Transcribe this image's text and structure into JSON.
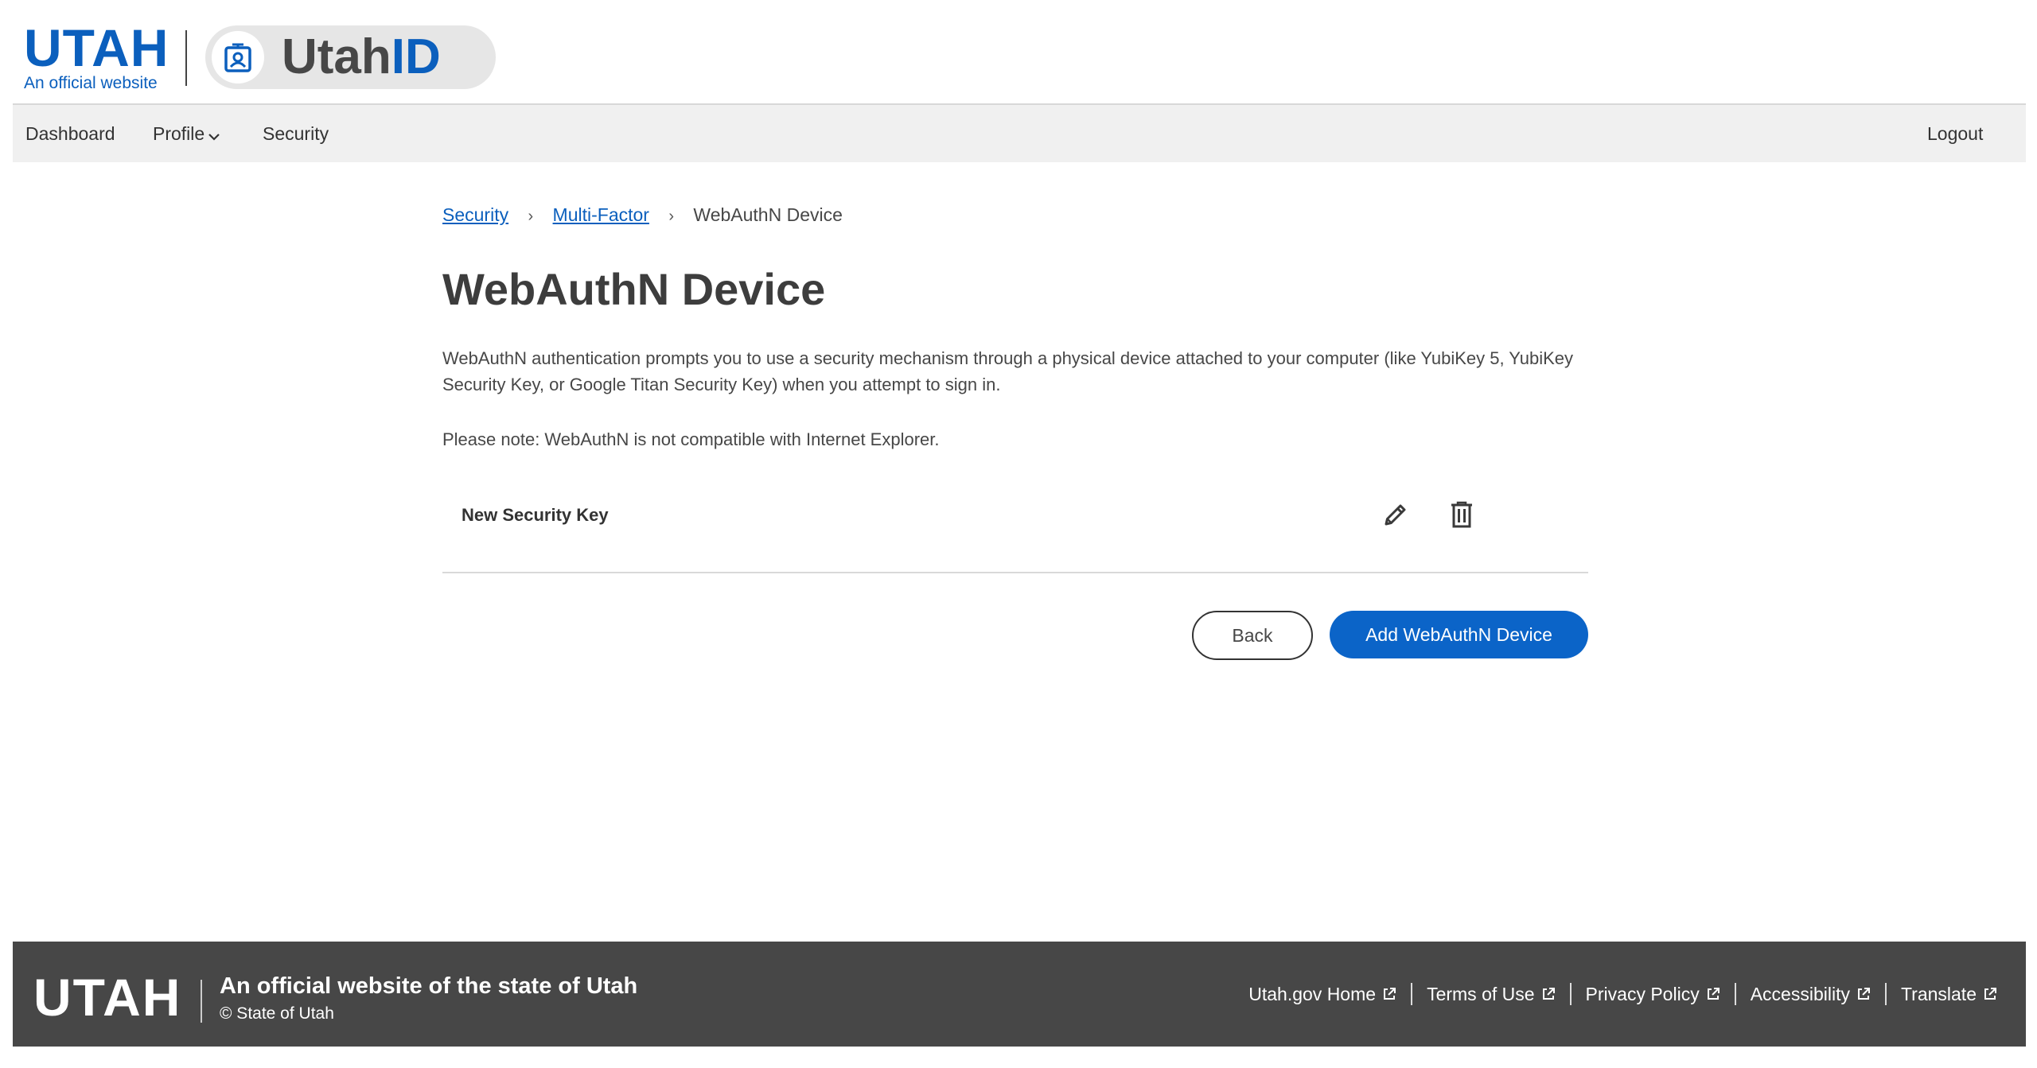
{
  "header": {
    "utah_logo": "UTAH",
    "utah_tagline": "An official website",
    "app_name_part1": "Utah",
    "app_name_part2": "ID",
    "brand_color": "#0b5fbd",
    "app_icon": "id-badge-icon"
  },
  "nav": {
    "items": [
      {
        "label": "Dashboard"
      },
      {
        "label": "Profile",
        "icon": "chevron-down-icon"
      },
      {
        "label": "Security"
      }
    ],
    "logout_label": "Logout"
  },
  "breadcrumb": {
    "items": [
      {
        "label": "Security"
      },
      {
        "label": "Multi-Factor"
      },
      {
        "label": "WebAuthN Device"
      }
    ],
    "separator": "›"
  },
  "main": {
    "title": "WebAuthN Device",
    "description": "WebAuthN authentication prompts you to use a security mechanism through a physical device attached to your computer (like YubiKey 5, YubiKey Security Key, or Google Titan Security Key) when you attempt to sign in.",
    "note": "Please note: WebAuthN is not compatible with Internet Explorer.",
    "devices": [
      {
        "name": "New Security Key",
        "edit_icon": "pencil-icon",
        "delete_icon": "trash-icon"
      }
    ],
    "back_label": "Back",
    "add_label": "Add WebAuthN Device"
  },
  "footer": {
    "utah_logo": "UTAH",
    "official_text": "An official website of the state of Utah",
    "copyright": "© State of Utah",
    "links": [
      {
        "label": "Utah.gov Home"
      },
      {
        "label": "Terms of Use"
      },
      {
        "label": "Privacy Policy"
      },
      {
        "label": "Accessibility"
      },
      {
        "label": "Translate"
      }
    ],
    "link_icon": "external-link-icon",
    "background": "#474747"
  }
}
